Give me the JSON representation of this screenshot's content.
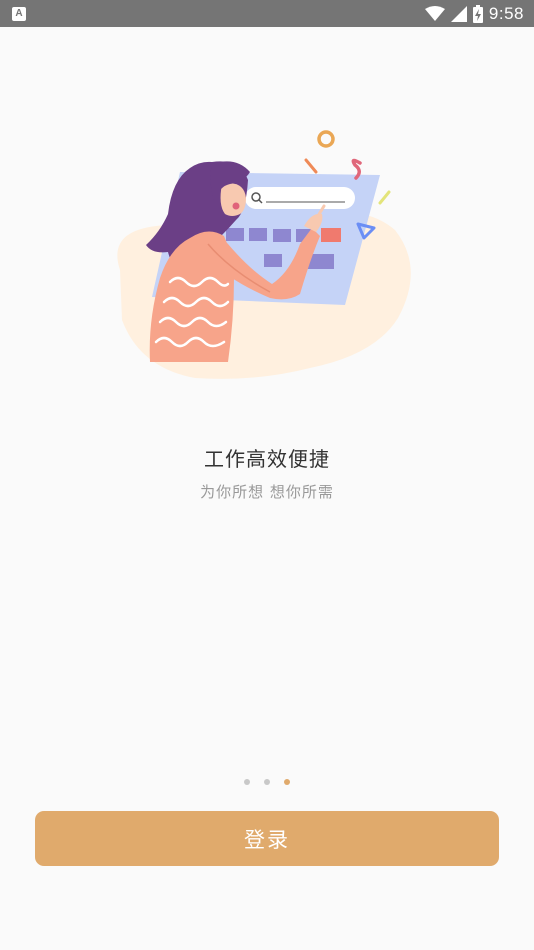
{
  "status_bar": {
    "notification_letter": "A",
    "time": "9:58",
    "icons": [
      "wifi-icon",
      "cell-signal-icon",
      "battery-charging-icon"
    ]
  },
  "illustration": {
    "subject": "woman-using-search-calendar",
    "colors": {
      "blob": "#fff0df",
      "board": "#c5d3f7",
      "cell_purple": "#8e87d0",
      "cell_red": "#f07a6e",
      "hair": "#6b3f86",
      "sweater": "#f7a48a",
      "skin": "#f8c9b0"
    }
  },
  "onboarding": {
    "title": "工作高效便捷",
    "subtitle": "为你所想 想你所需",
    "page_count": 3,
    "active_page": 3
  },
  "login_button": {
    "label": "登录"
  },
  "colors": {
    "accent": "#e0aa6c",
    "background": "#fafafa",
    "status_bar": "#757575"
  }
}
